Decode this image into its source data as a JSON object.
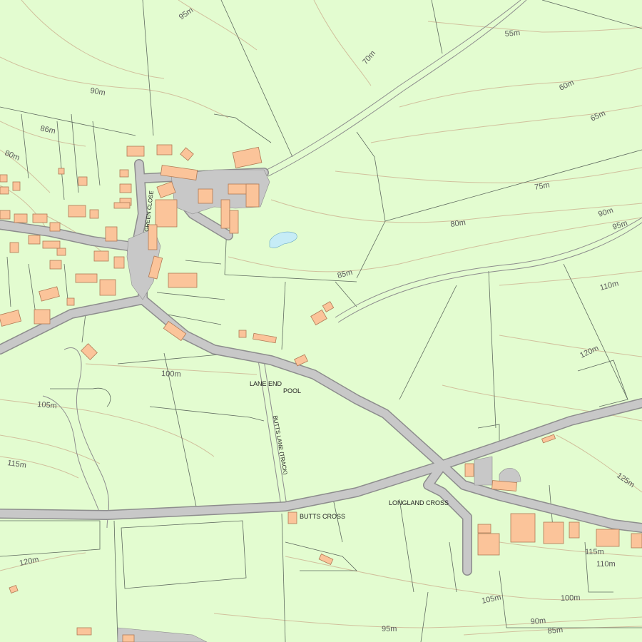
{
  "colors": {
    "land": "#e3fcd0",
    "road": "#c8c8c8",
    "road_edge": "#8d8d8d",
    "building": "#fbc49a",
    "building_edge": "#b07a55",
    "water": "#c6ecf6",
    "field_boundary": "#5f6b5f",
    "contour": "#d1c09d"
  },
  "place_labels": {
    "lane_end": "LANE END",
    "pool": "POOL",
    "butts_cross": "BUTTS CROSS",
    "longland_cross": "LONGLAND CROSS",
    "green_close": "GREEN CLOSE",
    "butts_lane": "BUTTS LANE (TRACK)"
  },
  "contour_labels": {
    "c95_top": "95m",
    "c55": "55m",
    "c70": "70m",
    "c60": "60m",
    "c90_left": "90m",
    "c65": "65m",
    "c86": "86m",
    "c80_left": "80m",
    "c75": "75m",
    "c90_right": "90m",
    "c95_right": "95m",
    "c80_mid": "80m",
    "c85": "85m",
    "c110": "110m",
    "c120_right": "120m",
    "c100": "100m",
    "c105_left": "105m",
    "c115_left": "115m",
    "c125": "125m",
    "c120_left": "120m",
    "c115_right": "115m",
    "c110_right": "110m",
    "c100_right": "100m",
    "c105_right": "105m",
    "c90_bottom": "90m",
    "c85_bottom": "85m",
    "c95_bottom": "95m"
  }
}
